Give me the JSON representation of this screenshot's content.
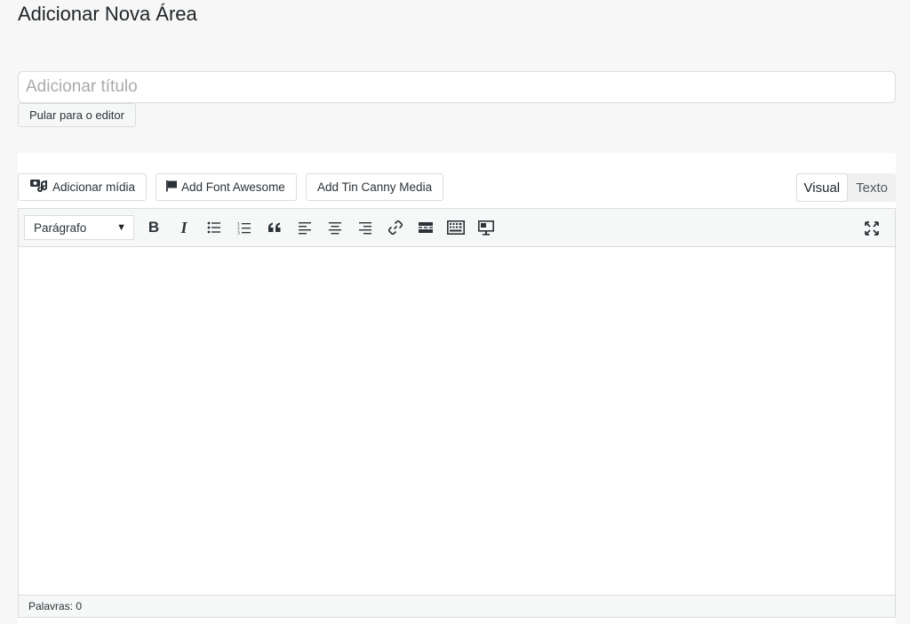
{
  "page": {
    "title": "Adicionar Nova Área"
  },
  "title_field": {
    "placeholder": "Adicionar título",
    "value": ""
  },
  "skip_button": {
    "label": "Pular para o editor"
  },
  "media_buttons": {
    "add_media": "Adicionar mídia",
    "font_awesome": "Add Font Awesome",
    "tin_canny": "Add Tin Canny Media"
  },
  "mode_tabs": {
    "visual": "Visual",
    "text": "Texto",
    "active": "visual"
  },
  "toolbar": {
    "format_select": "Parágrafo",
    "bold": "B",
    "italic": "I",
    "icons": [
      "bulleted-list-icon",
      "numbered-list-icon",
      "blockquote-icon",
      "align-left-icon",
      "align-center-icon",
      "align-right-icon",
      "link-icon",
      "read-more-icon",
      "toolbar-toggle-icon",
      "slides-icon",
      "fullscreen-icon"
    ]
  },
  "status_bar": {
    "word_count": "Palavras: 0"
  },
  "colors": {
    "background": "#f7f7f7",
    "border": "#dcdcde",
    "text": "#1d2327"
  }
}
